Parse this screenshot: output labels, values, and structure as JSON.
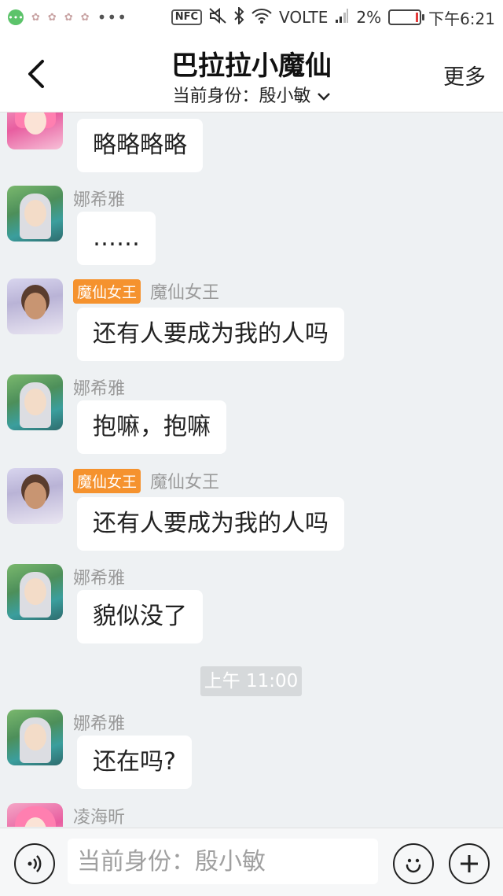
{
  "status_bar": {
    "nfc": "NFC",
    "network": "VOLTE",
    "battery": "2%",
    "battery_level": 0.02,
    "time": "下午6:21",
    "more_dots": "•••",
    "icons": [
      "notification-icon",
      "mute-icon",
      "bluetooth-icon",
      "wifi-icon",
      "signal-icon",
      "battery-icon"
    ]
  },
  "header": {
    "title": "巴拉拉小魔仙",
    "identity": "当前身份：殷小敏",
    "more": "更多",
    "back_icon": "back-chevron-icon"
  },
  "messages": [
    {
      "sender": "",
      "badge": "",
      "text": "略略略略"
    },
    {
      "sender": "娜希雅",
      "badge": "",
      "text": "……"
    },
    {
      "sender": "魔仙女王",
      "badge": "魔仙女王",
      "text": "还有人要成为我的人吗"
    },
    {
      "sender": "娜希雅",
      "badge": "",
      "text": "抱嘛，抱嘛"
    },
    {
      "sender": "魔仙女王",
      "badge": "魔仙女王",
      "text": "还有人要成为我的人吗"
    },
    {
      "sender": "娜希雅",
      "badge": "",
      "text": "貌似没了"
    },
    {
      "sender": "娜希雅",
      "badge": "",
      "text": "还在吗?"
    },
    {
      "sender": "凌海昕",
      "badge": "",
      "text": ""
    }
  ],
  "timestamp": "上午 11:00",
  "input": {
    "placeholder": "当前身份：殷小敏"
  },
  "colors": {
    "badge": "#f5922e",
    "chat_bg": "#eef1f3",
    "timestamp_bg": "#d6d9db"
  }
}
